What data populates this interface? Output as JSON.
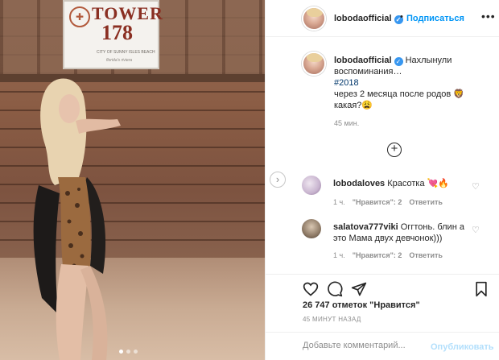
{
  "photo": {
    "sign_title": "TOWER",
    "sign_number": "178",
    "sign_subtitle": "CITY OF SUNNY ISLES BEACH",
    "sign_script": "florida's riviera",
    "carousel_dots": 3,
    "active_dot": 0
  },
  "header": {
    "username": "lobodaofficial",
    "separator": "•",
    "follow_label": "Подписаться",
    "more_label": "•••"
  },
  "caption": {
    "username": "lobodaofficial",
    "line1": "Нахлынули воспоминания…",
    "hashtag": "#2018",
    "line2": "через 2 месяца после родов 🦁",
    "line3": "какая?😩",
    "time": "45 мин."
  },
  "load_more": "⊕",
  "comments": [
    {
      "username": "lobodaloves",
      "text": "Красотка 💘🔥",
      "time": "1 ч.",
      "likes": "\"Нравится\": 2",
      "reply": "Ответить"
    },
    {
      "username": "salatova777viki",
      "text": "Оггтонь. блин а это Мама двух девчонок)))",
      "time": "1 ч.",
      "likes": "\"Нравится\": 2",
      "reply": "Ответить"
    }
  ],
  "stats": {
    "likes": "26 747 отметок \"Нравится\"",
    "posted": "45 МИНУТ НАЗАД"
  },
  "add_comment": {
    "placeholder": "Добавьте комментарий...",
    "publish_label": "Опубликовать"
  },
  "colors": {
    "link_blue": "#0095f6",
    "verified_blue": "#3897f0",
    "muted": "#8e8e8e",
    "publish_disabled": "#b2dffc"
  }
}
